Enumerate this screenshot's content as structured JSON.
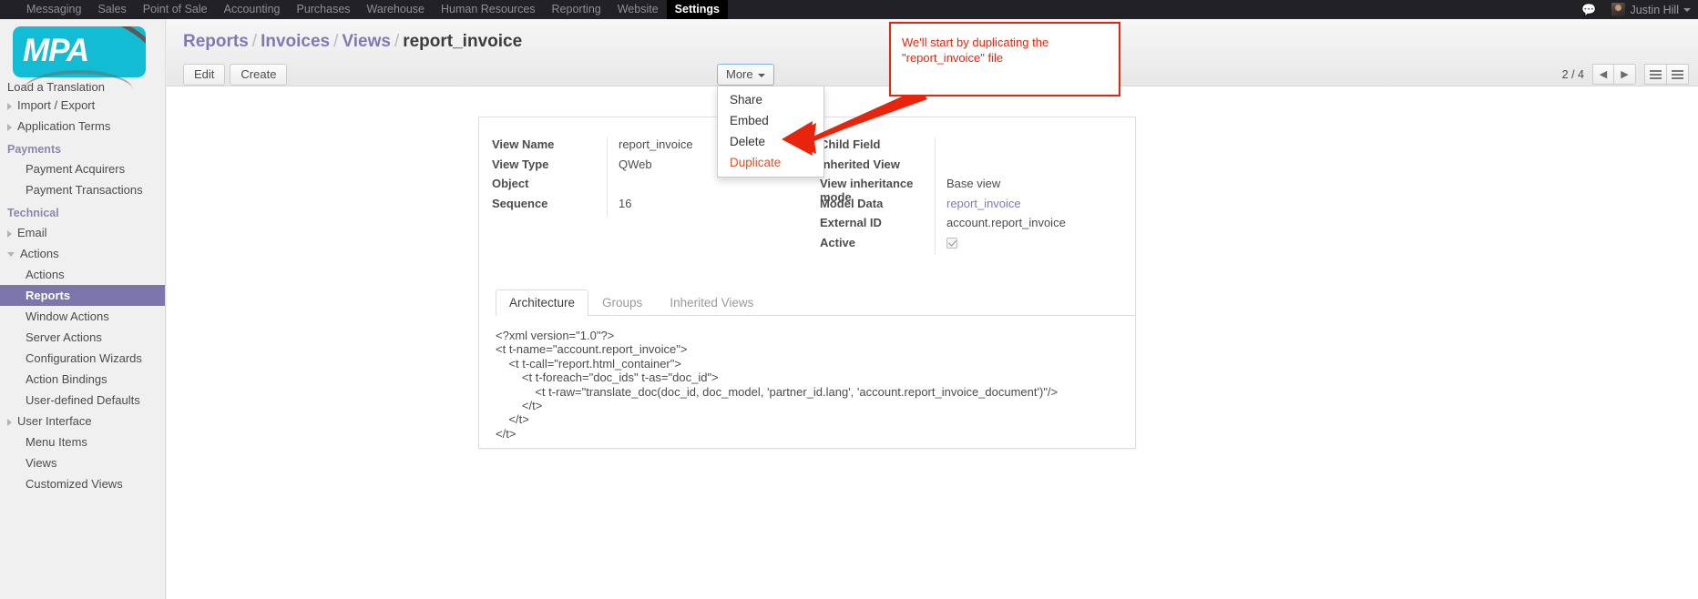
{
  "topbar": {
    "menu": [
      {
        "label": "Messaging",
        "active": false
      },
      {
        "label": "Sales",
        "active": false
      },
      {
        "label": "Point of Sale",
        "active": false
      },
      {
        "label": "Accounting",
        "active": false
      },
      {
        "label": "Purchases",
        "active": false
      },
      {
        "label": "Warehouse",
        "active": false
      },
      {
        "label": "Human Resources",
        "active": false
      },
      {
        "label": "Reporting",
        "active": false
      },
      {
        "label": "Website",
        "active": false
      },
      {
        "label": "Settings",
        "active": true
      }
    ],
    "chat_icon": "messages-icon",
    "username": "Justin Hill"
  },
  "sidebar": {
    "logo_text": "MPA",
    "items": [
      {
        "label": "Load a Translation",
        "level": 1,
        "arrow": "none",
        "clipped": true
      },
      {
        "label": "Import / Export",
        "level": 1,
        "arrow": "collapsed"
      },
      {
        "label": "Application Terms",
        "level": 1,
        "arrow": "collapsed"
      },
      {
        "label": "Payments",
        "level": 0,
        "group": true
      },
      {
        "label": "Payment Acquirers",
        "level": 2
      },
      {
        "label": "Payment Transactions",
        "level": 2
      },
      {
        "label": "Technical",
        "level": 0,
        "group": true
      },
      {
        "label": "Email",
        "level": 1,
        "arrow": "collapsed"
      },
      {
        "label": "Actions",
        "level": 1,
        "arrow": "expanded"
      },
      {
        "label": "Actions",
        "level": 2
      },
      {
        "label": "Reports",
        "level": 2,
        "selected": true
      },
      {
        "label": "Window Actions",
        "level": 2
      },
      {
        "label": "Server Actions",
        "level": 2
      },
      {
        "label": "Configuration Wizards",
        "level": 2
      },
      {
        "label": "Action Bindings",
        "level": 2
      },
      {
        "label": "User-defined Defaults",
        "level": 2
      },
      {
        "label": "User Interface",
        "level": 1,
        "arrow": "collapsed"
      },
      {
        "label": "Menu Items",
        "level": 2
      },
      {
        "label": "Views",
        "level": 2
      },
      {
        "label": "Customized Views",
        "level": 2
      }
    ]
  },
  "control_panel": {
    "breadcrumb": [
      {
        "label": "Reports",
        "current": false
      },
      {
        "label": "Invoices",
        "current": false
      },
      {
        "label": "Views",
        "current": false
      },
      {
        "label": "report_invoice",
        "current": true
      }
    ],
    "breadcrumb_separator": "/",
    "edit_label": "Edit",
    "create_label": "Create",
    "more_label": "More",
    "more_menu": [
      {
        "label": "Share",
        "highlighted": false
      },
      {
        "label": "Embed",
        "highlighted": false
      },
      {
        "label": "Delete",
        "highlighted": false
      },
      {
        "label": "Duplicate",
        "highlighted": true
      }
    ],
    "pager_text": "2 / 4",
    "prev_icon": "chevron-left-icon",
    "next_icon": "chevron-right-icon",
    "list_view_icon": "list-view-icon",
    "form_view_icon": "form-view-icon"
  },
  "form": {
    "left_fields": [
      {
        "label": "View Name",
        "value": "report_invoice"
      },
      {
        "label": "View Type",
        "value": "QWeb"
      },
      {
        "label": "Object",
        "value": ""
      },
      {
        "label": "Sequence",
        "value": "16"
      }
    ],
    "right_fields": [
      {
        "label": "Child Field",
        "value": ""
      },
      {
        "label": "Inherited View",
        "value": ""
      },
      {
        "label": "View inheritance mode",
        "value": "Base view"
      },
      {
        "label": "Model Data",
        "value": "report_invoice",
        "link": true
      },
      {
        "label": "External ID",
        "value": "account.report_invoice"
      },
      {
        "label": "Active",
        "value": "",
        "checkbox": true,
        "checked": true
      }
    ],
    "tabs": [
      {
        "label": "Architecture",
        "active": true
      },
      {
        "label": "Groups",
        "active": false
      },
      {
        "label": "Inherited Views",
        "active": false
      }
    ],
    "architecture_code": "<?xml version=\"1.0\"?>\n<t t-name=\"account.report_invoice\">\n    <t t-call=\"report.html_container\">\n        <t t-foreach=\"doc_ids\" t-as=\"doc_id\">\n            <t t-raw=\"translate_doc(doc_id, doc_model, 'partner_id.lang', 'account.report_invoice_document')\"/>\n        </t>\n    </t>\n</t>"
  },
  "annotation": {
    "text": "We'll start by duplicating the \"report_invoice\" file",
    "color": "#e8250c",
    "arrow_icon": "red-arrow-pointer"
  }
}
